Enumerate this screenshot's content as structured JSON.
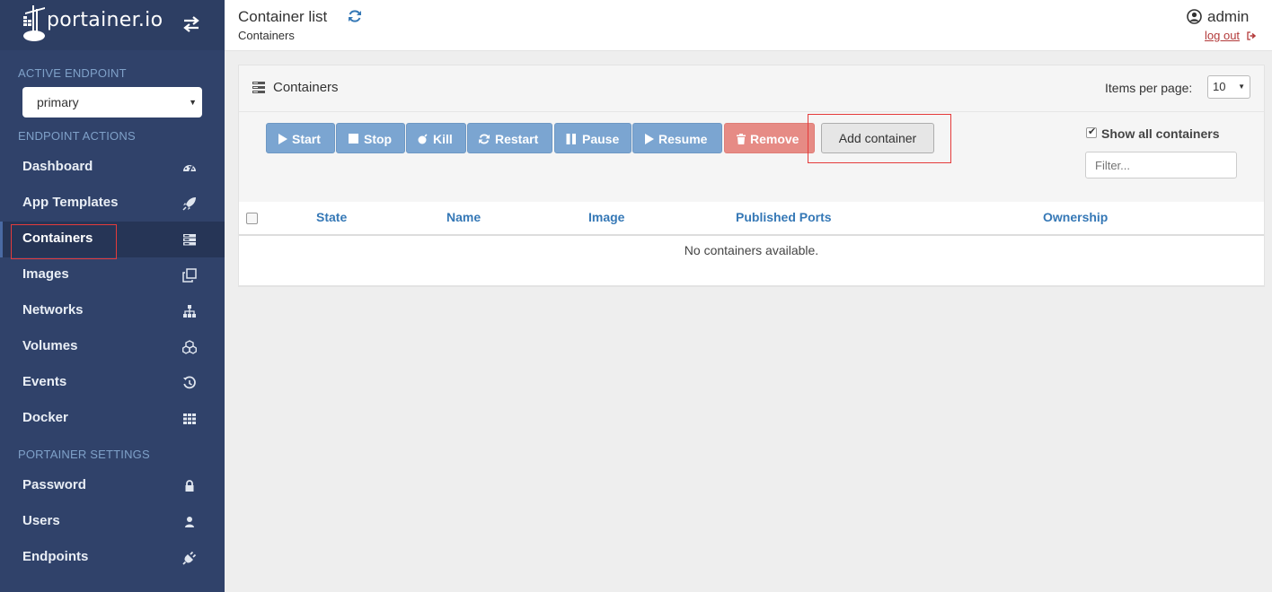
{
  "brand": {
    "name": "portainer.io"
  },
  "sidebar": {
    "active_endpoint_title": "ACTIVE ENDPOINT",
    "endpoint_value": "primary",
    "endpoint_actions_title": "ENDPOINT ACTIONS",
    "items": [
      {
        "label": "Dashboard",
        "icon": "tachometer-icon"
      },
      {
        "label": "App Templates",
        "icon": "rocket-icon"
      },
      {
        "label": "Containers",
        "icon": "server-icon",
        "active": true
      },
      {
        "label": "Images",
        "icon": "clone-icon"
      },
      {
        "label": "Networks",
        "icon": "sitemap-icon"
      },
      {
        "label": "Volumes",
        "icon": "cubes-icon"
      },
      {
        "label": "Events",
        "icon": "history-icon"
      },
      {
        "label": "Docker",
        "icon": "th-icon"
      }
    ],
    "settings_title": "PORTAINER SETTINGS",
    "settings_items": [
      {
        "label": "Password",
        "icon": "lock-icon"
      },
      {
        "label": "Users",
        "icon": "user-icon"
      },
      {
        "label": "Endpoints",
        "icon": "plug-icon"
      }
    ]
  },
  "header": {
    "title": "Container list",
    "breadcrumb": "Containers",
    "username": "admin",
    "logout": "log out"
  },
  "panel": {
    "title": "Containers",
    "items_per_page_label": "Items per page:",
    "items_per_page_value": "10",
    "actions": {
      "start": "Start",
      "stop": "Stop",
      "kill": "Kill",
      "restart": "Restart",
      "pause": "Pause",
      "resume": "Resume",
      "remove": "Remove",
      "add": "Add container"
    },
    "show_all_label": "Show all containers",
    "show_all_checked": true,
    "filter_placeholder": "Filter...",
    "columns": [
      "State",
      "Name",
      "Image",
      "Published Ports",
      "Ownership"
    ],
    "empty_message": "No containers available."
  },
  "colors": {
    "sidebar_bg": "#30426a",
    "primary_button": "#7ba5d1",
    "danger_button": "#e68b85",
    "link_blue": "#3578b6",
    "highlight_red": "#e53b3b"
  }
}
